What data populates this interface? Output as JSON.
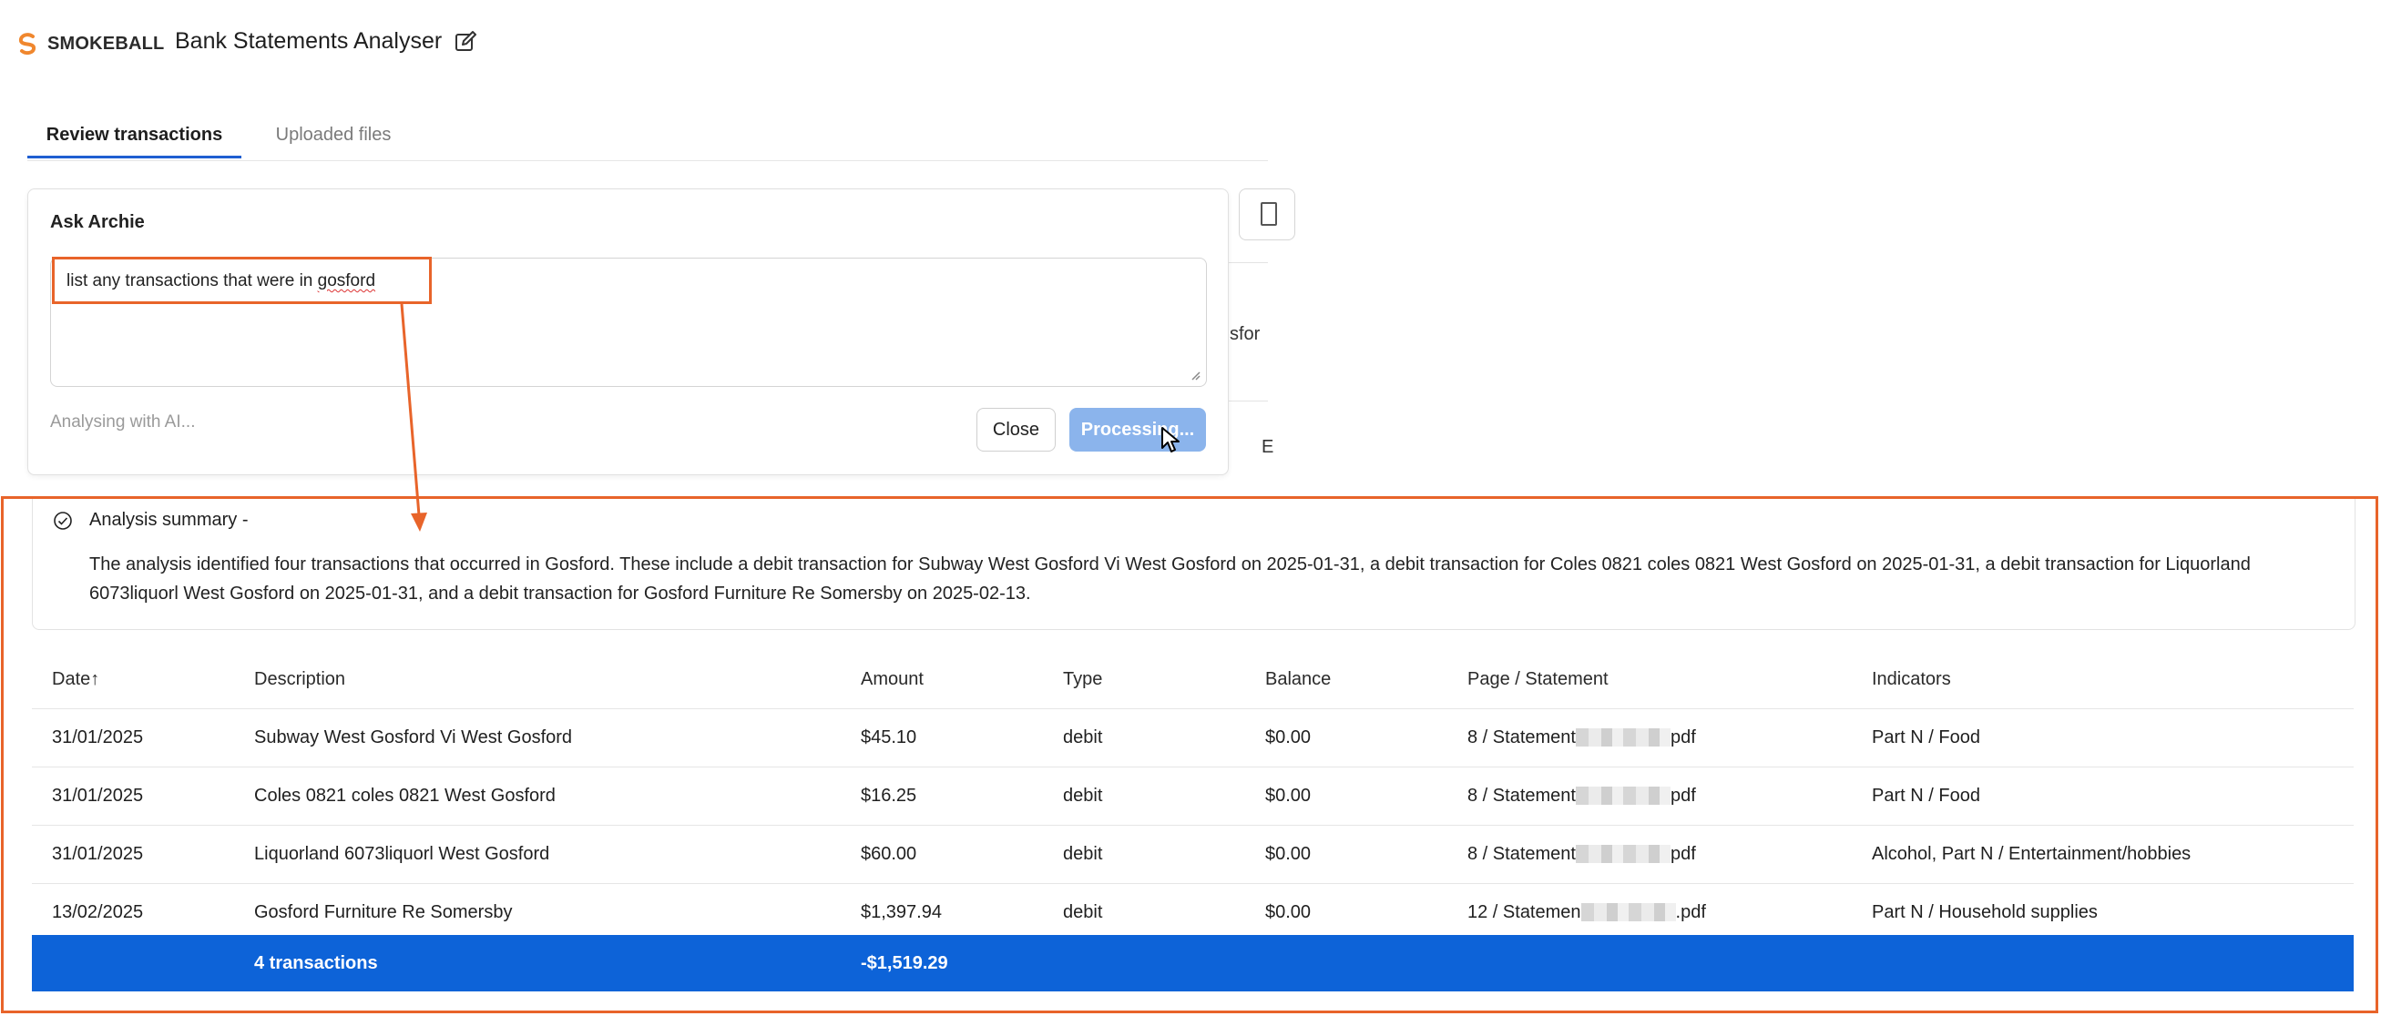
{
  "header": {
    "brand": "SMOKEBALL",
    "app_title": "Bank Statements Analyser",
    "colors": {
      "brand_orange": "#f0872e",
      "accent_blue": "#1f5fd1"
    }
  },
  "tabs": [
    {
      "label": "Review transactions",
      "active": true
    },
    {
      "label": "Uploaded files",
      "active": false
    }
  ],
  "background": {
    "partial_text_1": "sfor",
    "partial_text_2": "E"
  },
  "ask_archie": {
    "title": "Ask Archie",
    "query_prefix": "list any transactions that were in ",
    "query_misspelled": "gosford",
    "status": "Analysing with AI...",
    "close_label": "Close",
    "process_label": "Processing..."
  },
  "summary": {
    "title": "Analysis summary -",
    "text": "The analysis identified four transactions that occurred in Gosford. These include a debit transaction for Subway West Gosford Vi West Gosford on 2025-01-31, a debit transaction for Coles 0821 coles 0821 West Gosford on 2025-01-31, a debit transaction for Liquorland 6073liquorl West Gosford on 2025-01-31, and a debit transaction for Gosford Furniture Re Somersby on 2025-02-13."
  },
  "table": {
    "headers": {
      "date": "Date↑",
      "description": "Description",
      "amount": "Amount",
      "type": "Type",
      "balance": "Balance",
      "page": "Page / Statement",
      "indicators": "Indicators"
    },
    "rows": [
      {
        "date": "31/01/2025",
        "description": "Subway West Gosford Vi West Gosford",
        "amount": "$45.10",
        "type": "debit",
        "balance": "$0.00",
        "page_prefix": "8 / Statement",
        "page_suffix": "pdf",
        "indicators": "Part N / Food"
      },
      {
        "date": "31/01/2025",
        "description": "Coles 0821 coles 0821 West Gosford",
        "amount": "$16.25",
        "type": "debit",
        "balance": "$0.00",
        "page_prefix": "8 / Statement",
        "page_suffix": "pdf",
        "indicators": "Part N / Food"
      },
      {
        "date": "31/01/2025",
        "description": "Liquorland 6073liquorl West Gosford",
        "amount": "$60.00",
        "type": "debit",
        "balance": "$0.00",
        "page_prefix": "8 / Statement",
        "page_suffix": "pdf",
        "indicators": "Alcohol, Part N / Entertainment/hobbies"
      },
      {
        "date": "13/02/2025",
        "description": "Gosford Furniture Re Somersby",
        "amount": "$1,397.94",
        "type": "debit",
        "balance": "$0.00",
        "page_prefix": "12 / Statemen",
        "page_suffix": ".pdf",
        "indicators": "Part N / Household supplies"
      }
    ],
    "total": {
      "count_label": "4 transactions",
      "amount": "-$1,519.29"
    }
  }
}
